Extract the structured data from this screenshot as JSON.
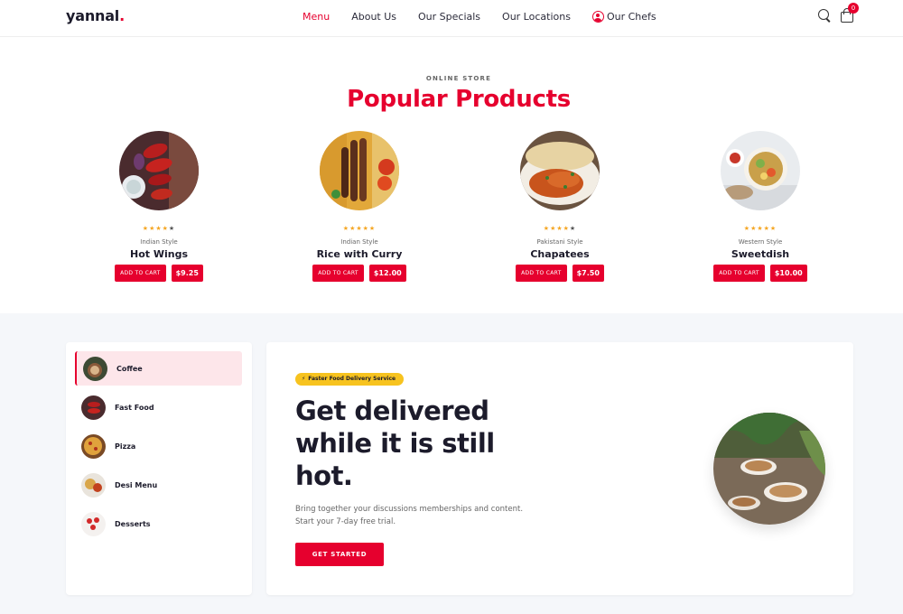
{
  "header": {
    "logo": "yannal",
    "logo_dot": ".",
    "nav": [
      "Menu",
      "About Us",
      "Our Specials",
      "Our Locations",
      "Our Chefs"
    ],
    "cart_count": "0",
    "colors": {
      "accent": "#e6002e"
    }
  },
  "products_section": {
    "eyebrow": "ONLINE STORE",
    "title": "Popular Products",
    "items": [
      {
        "rating": 4,
        "style": "Indian Style",
        "name": "Hot Wings",
        "cart_label": "ADD TO CART",
        "price": "$9.25",
        "image": "hot-wings-photo"
      },
      {
        "rating": 5,
        "style": "Indian Style",
        "name": "Rice with Curry",
        "cart_label": "ADD TO CART",
        "price": "$12.00",
        "image": "rice-curry-photo"
      },
      {
        "rating": 4,
        "style": "Pakistani Style",
        "name": "Chapatees",
        "cart_label": "ADD TO CART",
        "price": "$7.50",
        "image": "chapatees-photo"
      },
      {
        "rating": 5,
        "style": "Western Style",
        "name": "Sweetdish",
        "cart_label": "ADD TO CART",
        "price": "$10.00",
        "image": "sweetdish-photo"
      }
    ]
  },
  "categories": [
    {
      "label": "Coffee",
      "active": true
    },
    {
      "label": "Fast Food",
      "active": false
    },
    {
      "label": "Pizza",
      "active": false
    },
    {
      "label": "Desi Menu",
      "active": false
    },
    {
      "label": "Desserts",
      "active": false
    }
  ],
  "hero": {
    "pill": "Faster Food Delivery Service",
    "title": "Get delivered while it is still hot.",
    "text": "Bring together your discussions memberships and content. Start your 7-day free trial.",
    "cta": "GET STARTED",
    "image": "coffee-cups-photo"
  }
}
